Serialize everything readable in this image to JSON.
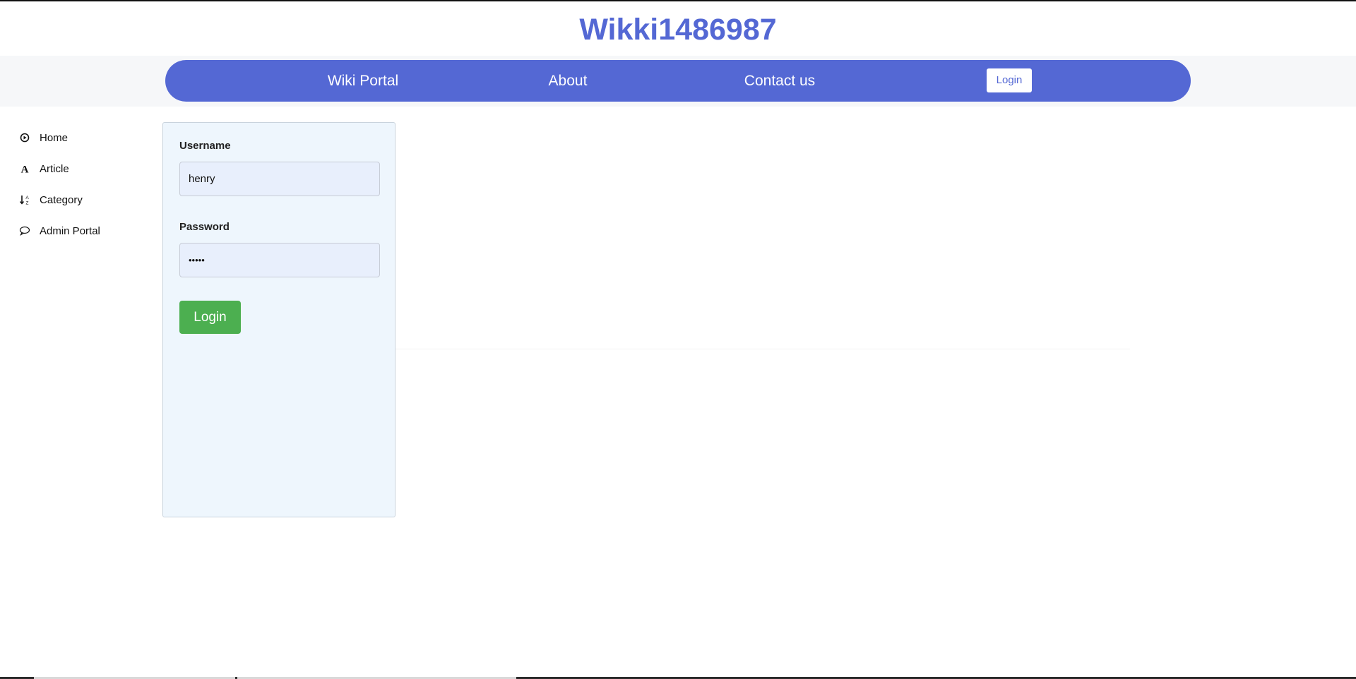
{
  "site": {
    "title": "Wikki1486987"
  },
  "nav": {
    "links": [
      "Wiki Portal",
      "About",
      "Contact us"
    ],
    "login_label": "Login"
  },
  "sidebar": {
    "items": [
      {
        "label": "Home",
        "icon": "play-circle-icon"
      },
      {
        "label": "Article",
        "icon": "font-a-icon"
      },
      {
        "label": "Category",
        "icon": "sort-alpha-icon"
      },
      {
        "label": "Admin Portal",
        "icon": "chat-bubble-icon"
      }
    ]
  },
  "login_form": {
    "username_label": "Username",
    "username_value": "henry",
    "password_label": "Password",
    "password_value": "•••••",
    "submit_label": "Login"
  },
  "colors": {
    "brand": "#5468d4",
    "submit": "#4caf50",
    "panel_bg": "#eef6fd"
  }
}
